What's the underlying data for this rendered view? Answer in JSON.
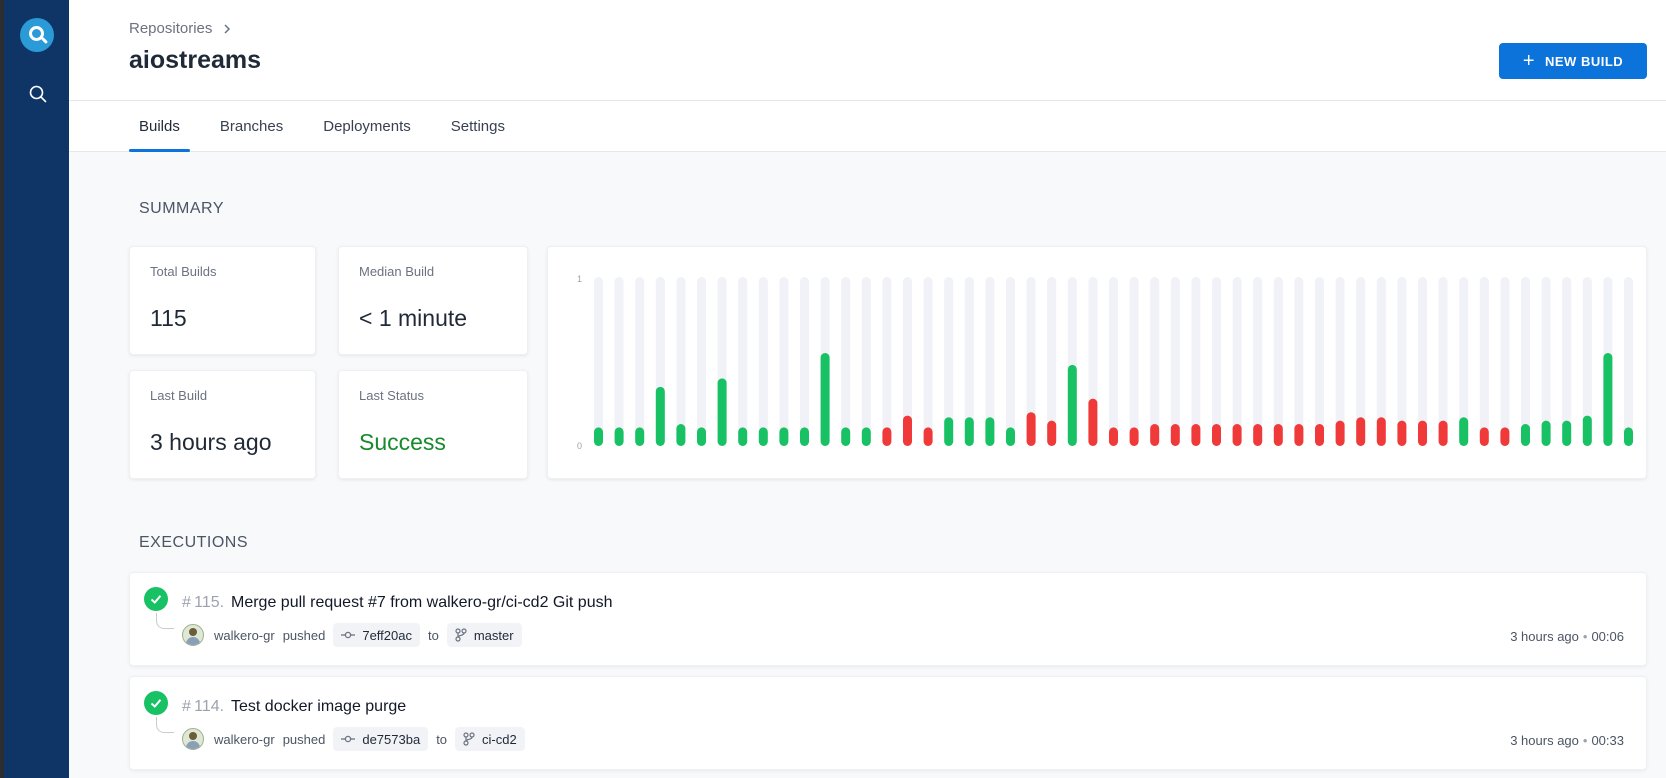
{
  "breadcrumb": {
    "parent": "Repositories"
  },
  "repo": {
    "name": "aiostreams"
  },
  "actions": {
    "new_build": "NEW BUILD"
  },
  "tabs": [
    {
      "label": "Builds",
      "active": true
    },
    {
      "label": "Branches",
      "active": false
    },
    {
      "label": "Deployments",
      "active": false
    },
    {
      "label": "Settings",
      "active": false
    }
  ],
  "summary": {
    "title": "SUMMARY",
    "total_builds_label": "Total Builds",
    "total_builds": "115",
    "median_build_label": "Median Build",
    "median_build": "< 1 minute",
    "last_build_label": "Last Build",
    "last_build": "3 hours ago",
    "last_status_label": "Last Status",
    "last_status": "Success"
  },
  "colors": {
    "success": "#17c164",
    "failure": "#f03a3a",
    "track": "#f1f2f7",
    "accent": "#0b73d9"
  },
  "chart_data": {
    "type": "bar",
    "ylim": [
      0,
      1
    ],
    "yticks": [
      "1",
      "0"
    ],
    "values": [
      0.11,
      0.11,
      0.11,
      0.35,
      0.13,
      0.11,
      0.4,
      0.11,
      0.11,
      0.11,
      0.11,
      0.55,
      0.11,
      0.11,
      0.11,
      0.18,
      0.11,
      0.17,
      0.17,
      0.17,
      0.11,
      0.2,
      0.15,
      0.48,
      0.28,
      0.11,
      0.11,
      0.13,
      0.13,
      0.13,
      0.13,
      0.13,
      0.13,
      0.13,
      0.13,
      0.13,
      0.15,
      0.17,
      0.17,
      0.15,
      0.15,
      0.15,
      0.17,
      0.11,
      0.11,
      0.13,
      0.15,
      0.15,
      0.18,
      0.55,
      0.11
    ],
    "status": [
      "success",
      "success",
      "success",
      "success",
      "success",
      "success",
      "success",
      "success",
      "success",
      "success",
      "success",
      "success",
      "success",
      "success",
      "failure",
      "failure",
      "failure",
      "success",
      "success",
      "success",
      "success",
      "failure",
      "failure",
      "success",
      "failure",
      "failure",
      "failure",
      "failure",
      "failure",
      "failure",
      "failure",
      "failure",
      "failure",
      "failure",
      "failure",
      "failure",
      "failure",
      "failure",
      "failure",
      "failure",
      "failure",
      "failure",
      "success",
      "failure",
      "failure",
      "success",
      "success",
      "success",
      "success",
      "success",
      "success"
    ]
  },
  "executions": {
    "title": "EXECUTIONS",
    "items": [
      {
        "number": "115.",
        "message": "Merge pull request #7 from walkero-gr/ci-cd2 Git push",
        "user": "walkero-gr",
        "action": "pushed",
        "commit": "7eff20ac",
        "to": "to",
        "branch": "master",
        "time": "3 hours ago",
        "duration": "00:06"
      },
      {
        "number": "114.",
        "message": "Test docker image purge",
        "user": "walkero-gr",
        "action": "pushed",
        "commit": "de7573ba",
        "to": "to",
        "branch": "ci-cd2",
        "time": "3 hours ago",
        "duration": "00:33"
      }
    ]
  }
}
